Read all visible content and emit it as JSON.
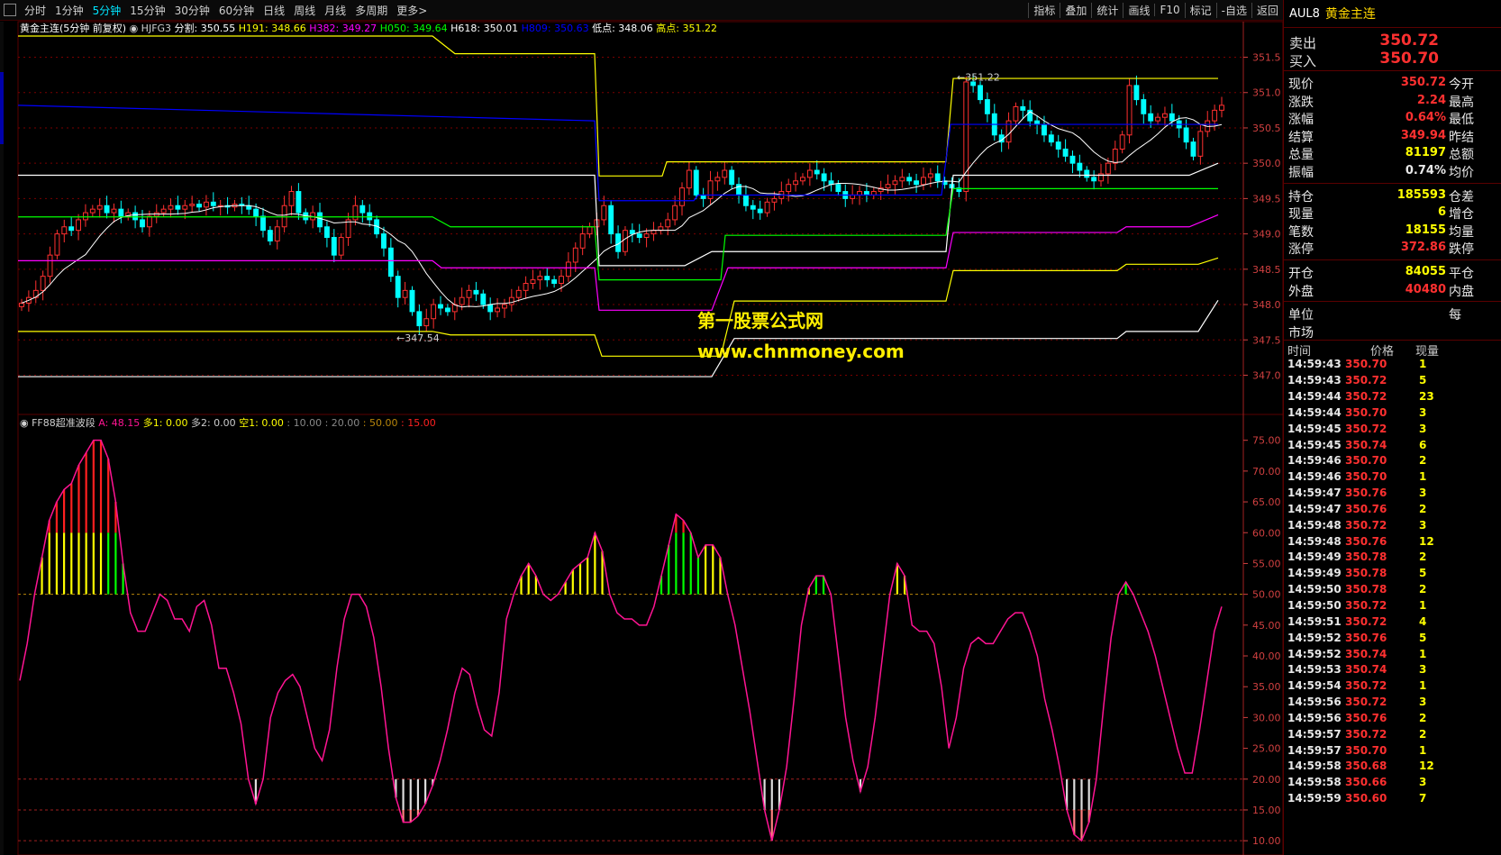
{
  "toolbar": {
    "periods": [
      "分时",
      "1分钟",
      "5分钟",
      "15分钟",
      "30分钟",
      "60分钟",
      "日线",
      "周线",
      "月线",
      "多周期",
      "更多>"
    ],
    "active_period": "5分钟",
    "right": [
      "指标",
      "叠加",
      "统计",
      "画线",
      "F10",
      "标记",
      "-自选",
      "返回"
    ]
  },
  "colors": {
    "up": "#ff3030",
    "down": "#00ffff",
    "yellow": "#ffff00",
    "blue": "#0000ff",
    "green": "#00ff00",
    "magenta": "#ff00ff",
    "white": "#ffffff",
    "pink": "#ff1493",
    "grid": "#7a0000",
    "axis": "#d04040"
  },
  "main_header": {
    "title": "黄金主连(5分钟 前复权)",
    "indicator": "HJFG3",
    "items": [
      {
        "t": "分割: 350.55",
        "c": "#ffffff"
      },
      {
        "t": "H191: 348.66",
        "c": "#ffff00"
      },
      {
        "t": "H382: 349.27",
        "c": "#ff00ff"
      },
      {
        "t": "H050: 349.64",
        "c": "#00ff00"
      },
      {
        "t": "H618: 350.01",
        "c": "#ffffff"
      },
      {
        "t": "H809: 350.63",
        "c": "#0000ff"
      },
      {
        "t": "低点: 348.06",
        "c": "#ffffff"
      },
      {
        "t": "高点: 351.22",
        "c": "#ffff00"
      }
    ]
  },
  "sub_header": {
    "title": "FF88超准波段",
    "items": [
      {
        "t": "A: 48.15",
        "c": "#ff1493"
      },
      {
        "t": "多1: 0.00",
        "c": "#ffff00"
      },
      {
        "t": "多2: 0.00",
        "c": "#cccccc"
      },
      {
        "t": "空1: 0.00",
        "c": "#ffff00"
      },
      {
        "t": ": 10.00",
        "c": "#888888"
      },
      {
        "t": ": 20.00",
        "c": "#888888"
      },
      {
        "t": ": 50.00",
        "c": "#b8860b"
      },
      {
        "t": ": 15.00",
        "c": "#ff2020"
      }
    ]
  },
  "annotations": {
    "high": "351.22",
    "low": "347.54"
  },
  "watermark": {
    "line1": "第一股票公式网",
    "line2": "www.chnmoney.com"
  },
  "chart_data": [
    {
      "type": "candlestick",
      "name": "main",
      "ylim": [
        346.7,
        351.8
      ],
      "y_ticks": [
        347.0,
        347.5,
        348.0,
        348.5,
        349.0,
        349.5,
        350.0,
        350.5,
        351.0,
        351.5
      ],
      "closes": [
        348.02,
        348.1,
        348.2,
        348.4,
        348.7,
        349.0,
        349.1,
        349.05,
        349.2,
        349.3,
        349.35,
        349.4,
        349.3,
        349.35,
        349.25,
        349.3,
        349.2,
        349.1,
        349.25,
        349.3,
        349.35,
        349.4,
        349.35,
        349.4,
        349.42,
        349.38,
        349.45,
        349.4,
        349.4,
        349.38,
        349.42,
        349.4,
        349.35,
        349.25,
        349.05,
        348.9,
        349.1,
        349.4,
        349.6,
        349.3,
        349.2,
        349.3,
        349.1,
        348.95,
        348.7,
        348.95,
        349.2,
        349.4,
        349.3,
        349.2,
        349.0,
        348.8,
        348.4,
        348.1,
        348.2,
        347.9,
        347.7,
        347.8,
        348.0,
        347.95,
        347.9,
        348.0,
        348.1,
        348.2,
        348.15,
        348.0,
        347.9,
        347.95,
        348.0,
        348.1,
        348.2,
        348.3,
        348.35,
        348.4,
        348.35,
        348.3,
        348.4,
        348.6,
        348.8,
        349.0,
        349.1,
        349.2,
        349.4,
        349.0,
        348.75,
        349.05,
        349.0,
        348.95,
        349.0,
        349.05,
        349.1,
        349.2,
        349.4,
        349.65,
        349.9,
        349.55,
        349.5,
        349.75,
        349.8,
        349.9,
        349.7,
        349.55,
        349.4,
        349.35,
        349.3,
        349.45,
        349.5,
        349.6,
        349.7,
        349.75,
        349.8,
        349.9,
        349.85,
        349.75,
        349.7,
        349.6,
        349.5,
        349.55,
        349.6,
        349.55,
        349.6,
        349.65,
        349.7,
        349.75,
        349.8,
        349.75,
        349.7,
        349.8,
        349.85,
        349.75,
        349.7,
        349.65,
        349.6,
        351.15,
        351.1,
        350.9,
        350.7,
        350.4,
        350.3,
        350.6,
        350.8,
        350.75,
        350.6,
        350.55,
        350.4,
        350.3,
        350.2,
        350.1,
        350.0,
        349.9,
        349.8,
        349.75,
        349.85,
        350.0,
        350.2,
        350.4,
        351.1,
        350.9,
        350.7,
        350.6,
        350.65,
        350.7,
        350.6,
        350.5,
        350.3,
        350.1,
        350.45,
        350.6,
        350.75,
        350.82
      ]
    },
    {
      "type": "line",
      "name": "FF88超准波段 A",
      "ylim": [
        9,
        77
      ],
      "y_ticks": [
        10,
        15,
        20,
        25,
        30,
        35,
        40,
        45,
        50,
        55,
        60,
        65,
        70,
        75
      ],
      "ref_lines": [
        10,
        15,
        20,
        50
      ],
      "values": [
        36,
        42,
        50,
        56,
        62,
        65,
        67,
        68,
        71,
        73,
        75,
        75,
        72,
        65,
        55,
        47,
        44,
        44,
        47,
        50,
        49,
        46,
        46,
        44,
        48,
        49,
        45,
        38,
        38,
        34,
        29,
        20,
        16,
        20,
        30,
        34,
        36,
        37,
        35,
        30,
        25,
        23,
        28,
        38,
        46,
        50,
        50,
        48,
        43,
        35,
        25,
        17,
        13,
        13,
        14,
        16,
        19,
        23,
        28,
        34,
        38,
        37,
        32,
        28,
        27,
        34,
        46,
        50,
        53,
        55,
        53,
        50,
        49,
        50,
        52,
        54,
        55,
        56,
        60,
        57,
        50,
        47,
        46,
        46,
        45,
        45,
        48,
        53,
        58,
        63,
        62,
        60,
        56,
        58,
        58,
        56,
        50,
        45,
        38,
        31,
        23,
        15,
        10,
        15,
        22,
        33,
        45,
        51,
        53,
        53,
        50,
        40,
        30,
        23,
        18,
        22,
        30,
        40,
        50,
        55,
        53,
        45,
        44,
        44,
        42,
        35,
        25,
        30,
        38,
        42,
        43,
        42,
        42,
        44,
        46,
        47,
        47,
        44,
        40,
        33,
        28,
        22,
        15,
        11,
        10,
        13,
        20,
        32,
        43,
        50,
        52,
        50,
        47,
        44,
        40,
        35,
        30,
        25,
        21,
        21,
        28,
        36,
        44,
        48
      ]
    }
  ],
  "right_panel": {
    "code": "AUL8",
    "name": "黄金主连",
    "sell": {
      "label": "卖出",
      "value": "350.72"
    },
    "buy": {
      "label": "买入",
      "value": "350.70"
    },
    "stats1": [
      {
        "a": "现价",
        "av": "350.72",
        "c": "#ff3030",
        "b": "今开"
      },
      {
        "a": "涨跌",
        "av": "2.24",
        "c": "#ff3030",
        "b": "最高"
      },
      {
        "a": "涨幅",
        "av": "0.64%",
        "c": "#ff3030",
        "b": "最低"
      },
      {
        "a": "结算",
        "av": "349.94",
        "c": "#ff3030",
        "b": "昨结"
      },
      {
        "a": "总量",
        "av": "81197",
        "c": "#ffff00",
        "b": "总额"
      },
      {
        "a": "振幅",
        "av": "0.74%",
        "c": "#e8e8e8",
        "b": "均价"
      }
    ],
    "stats2": [
      {
        "a": "持仓",
        "av": "185593",
        "c": "#ffff00",
        "b": "仓差"
      },
      {
        "a": "现量",
        "av": "6",
        "c": "#ffff00",
        "b": "增仓"
      },
      {
        "a": "笔数",
        "av": "18155",
        "c": "#ffff00",
        "b": "均量"
      },
      {
        "a": "涨停",
        "av": "372.86",
        "c": "#ff3030",
        "b": "跌停"
      }
    ],
    "stats3": [
      {
        "a": "开仓",
        "av": "84055",
        "c": "#ffff00",
        "b": "平仓"
      },
      {
        "a": "外盘",
        "av": "40480",
        "c": "#ff3030",
        "b": "内盘"
      }
    ],
    "stats4": [
      {
        "a": "单位",
        "av": "",
        "c": "#e8e8e8",
        "b": "每"
      },
      {
        "a": "市场",
        "av": "",
        "c": "#e8e8e8",
        "b": ""
      }
    ],
    "tick_header": {
      "time": "时间",
      "price": "价格",
      "vol": "现量"
    },
    "ticks": [
      {
        "t": "14:59:43",
        "p": "350.70",
        "v": "1"
      },
      {
        "t": "14:59:43",
        "p": "350.72",
        "v": "5"
      },
      {
        "t": "14:59:44",
        "p": "350.72",
        "v": "23"
      },
      {
        "t": "14:59:44",
        "p": "350.70",
        "v": "3"
      },
      {
        "t": "14:59:45",
        "p": "350.72",
        "v": "3"
      },
      {
        "t": "14:59:45",
        "p": "350.74",
        "v": "6"
      },
      {
        "t": "14:59:46",
        "p": "350.70",
        "v": "2"
      },
      {
        "t": "14:59:46",
        "p": "350.70",
        "v": "1"
      },
      {
        "t": "14:59:47",
        "p": "350.76",
        "v": "3"
      },
      {
        "t": "14:59:47",
        "p": "350.76",
        "v": "2"
      },
      {
        "t": "14:59:48",
        "p": "350.72",
        "v": "3"
      },
      {
        "t": "14:59:48",
        "p": "350.76",
        "v": "12"
      },
      {
        "t": "14:59:49",
        "p": "350.78",
        "v": "2"
      },
      {
        "t": "14:59:49",
        "p": "350.78",
        "v": "5"
      },
      {
        "t": "14:59:50",
        "p": "350.78",
        "v": "2"
      },
      {
        "t": "14:59:50",
        "p": "350.72",
        "v": "1"
      },
      {
        "t": "14:59:51",
        "p": "350.72",
        "v": "4"
      },
      {
        "t": "14:59:52",
        "p": "350.76",
        "v": "5"
      },
      {
        "t": "14:59:52",
        "p": "350.74",
        "v": "1"
      },
      {
        "t": "14:59:53",
        "p": "350.74",
        "v": "3"
      },
      {
        "t": "14:59:54",
        "p": "350.72",
        "v": "1"
      },
      {
        "t": "14:59:56",
        "p": "350.72",
        "v": "3"
      },
      {
        "t": "14:59:56",
        "p": "350.76",
        "v": "2"
      },
      {
        "t": "14:59:57",
        "p": "350.72",
        "v": "2"
      },
      {
        "t": "14:59:57",
        "p": "350.70",
        "v": "1"
      },
      {
        "t": "14:59:58",
        "p": "350.68",
        "v": "12"
      },
      {
        "t": "14:59:58",
        "p": "350.66",
        "v": "3"
      },
      {
        "t": "14:59:59",
        "p": "350.60",
        "v": "7"
      }
    ]
  }
}
